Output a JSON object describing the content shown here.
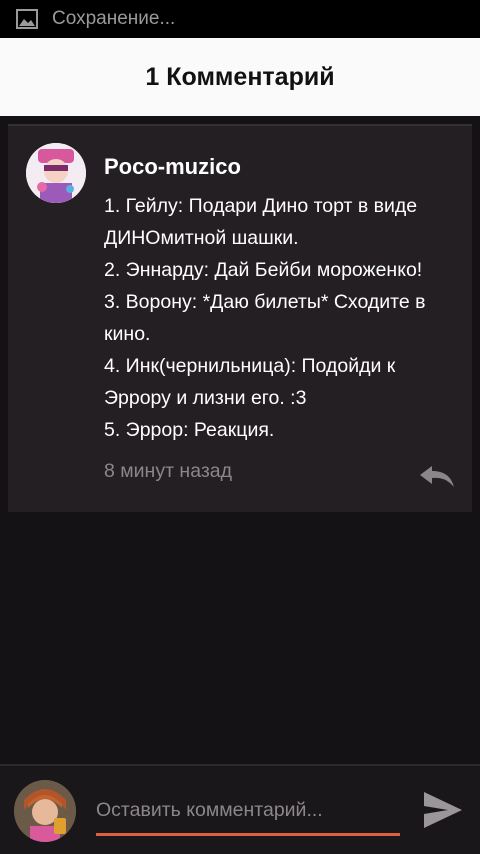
{
  "status_bar": {
    "text": "Сохранение...",
    "icon": "image-icon"
  },
  "header": {
    "title": "1 Комментарий"
  },
  "comment": {
    "author": "Poco-muzico",
    "lines": [
      "1. Гейлу: Подари Дино торт в виде",
      "ДИНОмитной шашки.",
      "2. Эннарду: Дай Бейби мороженко!",
      "3. Ворону: *Даю билеты* Сходите в",
      "кино.",
      "4. Инк(чернильница): Подойди к",
      "Эррору и лизни его. :3",
      "5. Эррор: Реакция."
    ],
    "time": "8 минут назад",
    "reply_icon": "reply-icon"
  },
  "composer": {
    "placeholder": "Оставить комментарий...",
    "send_icon": "send-icon",
    "accent_color": "#e0603e"
  }
}
